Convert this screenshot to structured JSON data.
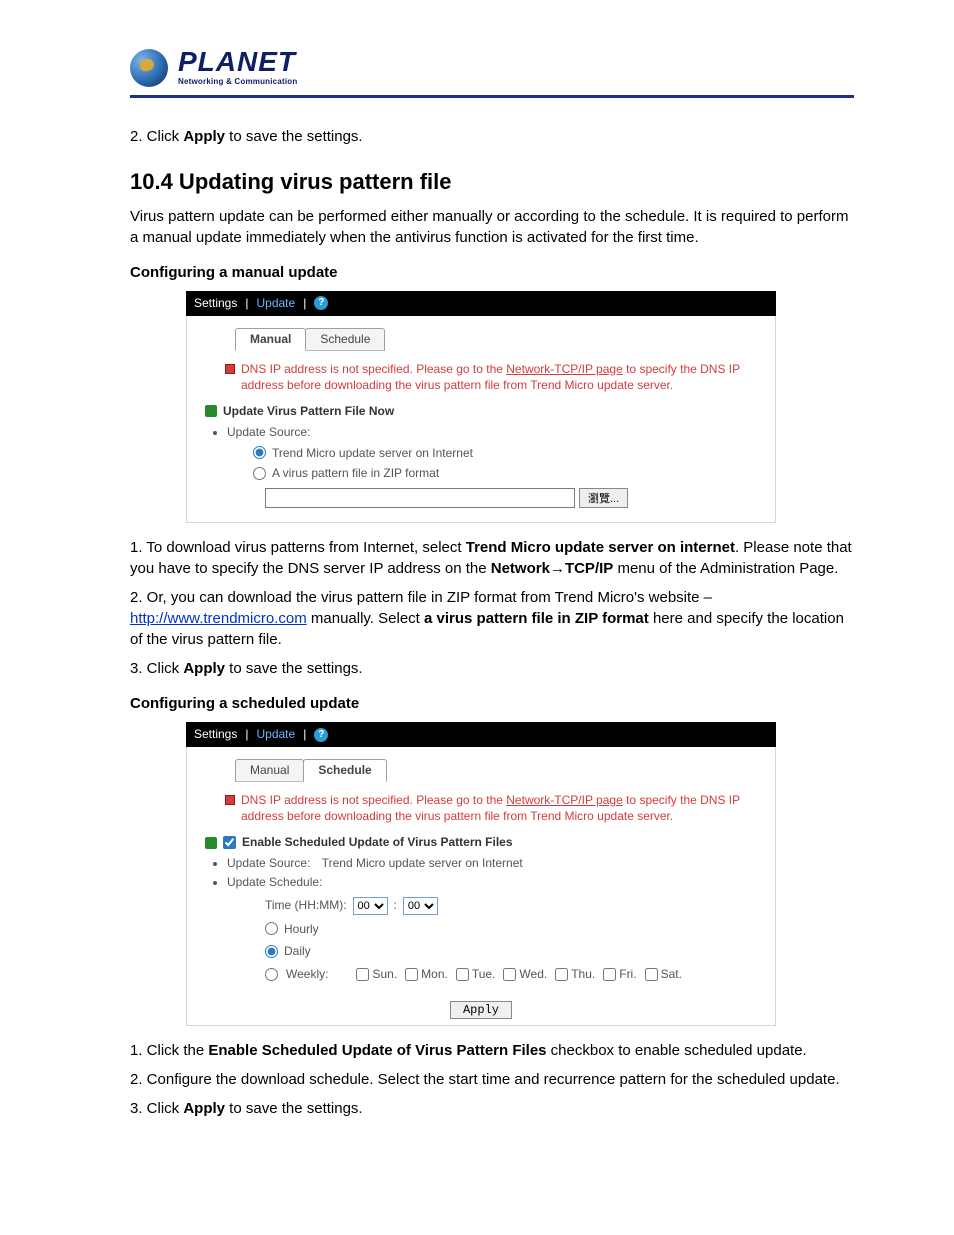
{
  "logo": {
    "brand": "PLANET",
    "tagline": "Networking & Communication"
  },
  "intro_step2": {
    "prefix": "2. Click ",
    "bold": "Apply",
    "suffix": " to save the settings."
  },
  "section_title": "10.4 Updating virus pattern file",
  "section_desc": "Virus pattern update can be performed either manually or according to the schedule. It is required to perform a manual update immediately when the antivirus function is activated for the first time.",
  "manual_heading": "Configuring a manual update",
  "shot1": {
    "breadcrumb": {
      "settings": "Settings",
      "update": "Update"
    },
    "help": "?",
    "tabs": {
      "manual": "Manual",
      "schedule": "Schedule"
    },
    "alert_pre": "DNS IP address is not specified. Please go to the ",
    "alert_link": "Network-TCP/IP page",
    "alert_post": " to specify the DNS IP address before downloading the virus pattern file from Trend Micro update server.",
    "title": "Update Virus Pattern File Now",
    "update_source_label": "Update Source:",
    "radio_internet": "Trend Micro update server on Internet",
    "radio_zip": "A virus pattern file in ZIP format",
    "browse": "瀏覽..."
  },
  "steps_manual": {
    "s1a": "1. To download virus patterns from Internet, select ",
    "s1b": "Trend Micro update server on internet",
    "s1c": ". Please note that you have to specify the DNS server IP address on the ",
    "s1d": "Network",
    "s1arrow": "→",
    "s1e": "TCP/IP",
    "s1f": " menu of the Administration Page.",
    "s2a": "2. Or, you can download the virus pattern file in ZIP format from Trend Micro's website – ",
    "s2url": "http://www.trendmicro.com",
    "s2b": " manually. Select ",
    "s2c": "a virus pattern file in ZIP format",
    "s2d": " here and specify the location of the virus pattern file.",
    "s3a": "3. Click ",
    "s3b": "Apply",
    "s3c": " to save the settings."
  },
  "sched_heading": "Configuring a scheduled update",
  "shot2": {
    "breadcrumb": {
      "settings": "Settings",
      "update": "Update"
    },
    "help": "?",
    "tabs": {
      "manual": "Manual",
      "schedule": "Schedule"
    },
    "alert_pre": "DNS IP address is not specified. Please go to the ",
    "alert_link": "Network-TCP/IP page",
    "alert_post": " to specify the DNS IP address before downloading the virus pattern file from Trend Micro update server.",
    "enable_label": "Enable Scheduled Update of Virus Pattern Files",
    "update_source_label": "Update Source:",
    "update_source_value": "Trend Micro update server on Internet",
    "update_schedule_label": "Update Schedule:",
    "time_label": "Time (HH:MM):",
    "hour": "00",
    "minute": "00",
    "hourly": "Hourly",
    "daily": "Daily",
    "weekly": "Weekly:",
    "days": {
      "sun": "Sun.",
      "mon": "Mon.",
      "tue": "Tue.",
      "wed": "Wed.",
      "thu": "Thu.",
      "fri": "Fri.",
      "sat": "Sat."
    },
    "apply": "Apply"
  },
  "steps_sched": {
    "s1a": "1. Click the ",
    "s1b": "Enable Scheduled Update of Virus Pattern Files",
    "s1c": " checkbox to enable scheduled update.",
    "s2": "2. Configure the download schedule. Select the start time and recurrence pattern for the scheduled update.",
    "s3a": "3. Click ",
    "s3b": "Apply",
    "s3c": " to save the settings."
  }
}
